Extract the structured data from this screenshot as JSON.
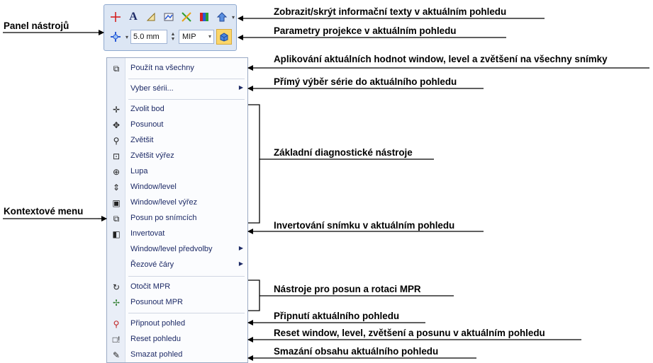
{
  "labels": {
    "panel": "Panel nástrojů",
    "context_menu": "Kontextové menu"
  },
  "toolbar": {
    "row1_icons": [
      "crosshair-icon",
      "text-a-icon",
      "ruler-icon",
      "overlay-icon",
      "cross-lines-icon",
      "color-map-icon",
      "orientation-icon"
    ],
    "thickness": "5.0 mm",
    "projection": "MIP"
  },
  "menu": {
    "items": [
      {
        "label": "Použít na všechny",
        "icon": "copy-icon"
      },
      {
        "label": "Vyber sérii...",
        "submenu": true
      },
      {
        "label": "Zvolit bod",
        "icon": "select-point-icon"
      },
      {
        "label": "Posunout",
        "icon": "move-icon"
      },
      {
        "label": "Zvětšit",
        "icon": "zoom-icon"
      },
      {
        "label": "Zvětšit výřez",
        "icon": "zoom-region-icon"
      },
      {
        "label": "Lupa",
        "icon": "magnifier-icon"
      },
      {
        "label": "Window/level",
        "icon": "window-level-icon"
      },
      {
        "label": "Window/level výřez",
        "icon": "window-level-region-icon"
      },
      {
        "label": "Posun po snímcích",
        "icon": "scroll-images-icon"
      },
      {
        "label": "Invertovat",
        "icon": "invert-icon"
      },
      {
        "label": "Window/level předvolby",
        "submenu": true
      },
      {
        "label": "Řezové čáry",
        "submenu": true
      },
      {
        "label": "Otočit MPR",
        "icon": "rotate-mpr-icon"
      },
      {
        "label": "Posunout MPR",
        "icon": "move-mpr-icon"
      },
      {
        "label": "Připnout pohled",
        "icon": "pin-icon"
      },
      {
        "label": "Reset pohledu",
        "icon": "reset-icon"
      },
      {
        "label": "Smazat pohled",
        "icon": "clear-icon"
      }
    ]
  },
  "annotations": [
    "Zobrazit/skrýt informační texty v aktuálním pohledu",
    "Parametry projekce v aktuálním pohledu",
    "Aplikování aktuálních hodnot window, level a zvětšení na všechny snímky",
    "Přímý výběr série do aktuálního pohledu",
    "Základní diagnostické nástroje",
    "Invertování snímku v aktuálním pohledu",
    "Nástroje pro posun a rotaci MPR",
    "Připnutí aktuálního pohledu",
    "Reset window, level, zvětšení a posunu v aktuálním pohledu",
    "Smazání obsahu aktuálního pohledu"
  ]
}
